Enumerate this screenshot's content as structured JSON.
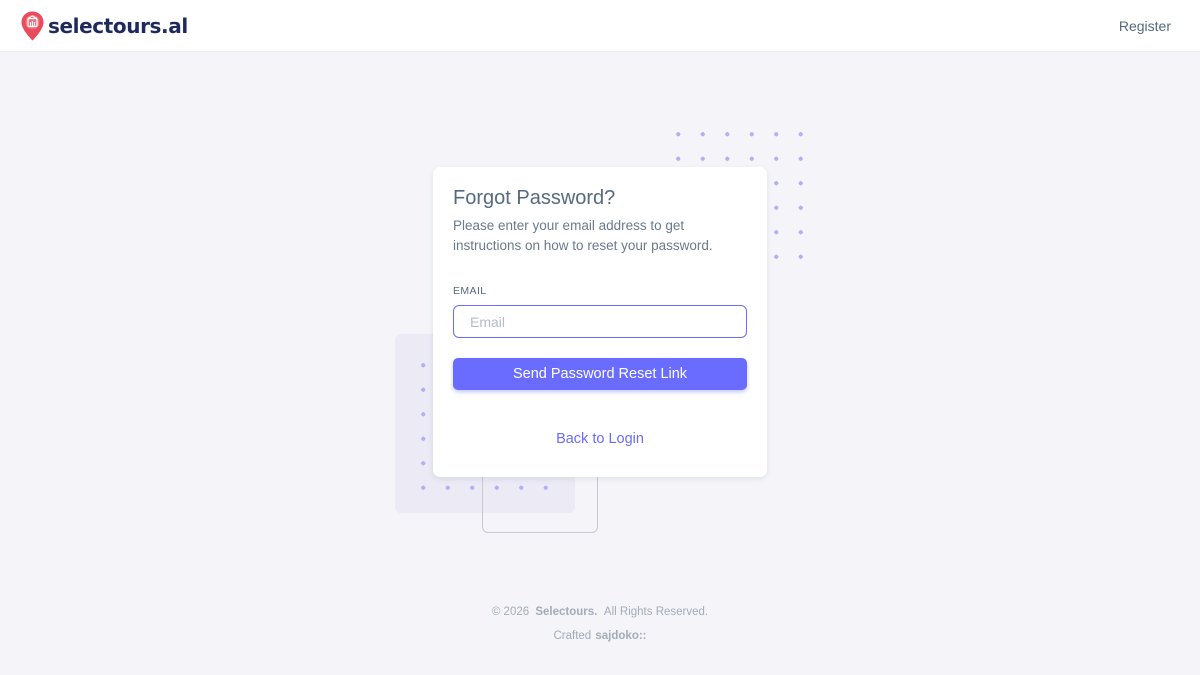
{
  "header": {
    "brand_name": "selectours.al",
    "register_label": "Register"
  },
  "card": {
    "title": "Forgot Password?",
    "description": "Please enter your email address to get instructions on how to reset your password.",
    "email_label": "EMAIL",
    "email_placeholder": "Email",
    "email_value": "",
    "submit_label": "Send Password Reset Link",
    "back_label": "Back to Login"
  },
  "footer": {
    "copyright": "© 2026",
    "company": "Selectours.",
    "rights": "All Rights Reserved.",
    "crafted_label": "Crafted",
    "author": "sajdoko::"
  },
  "colors": {
    "primary": "#696cff",
    "brand_text": "#1f2a5c",
    "brand_pin": "#ea4b5b",
    "background": "#f5f5f9"
  },
  "icons": {
    "brand": "location-pin-icon"
  }
}
